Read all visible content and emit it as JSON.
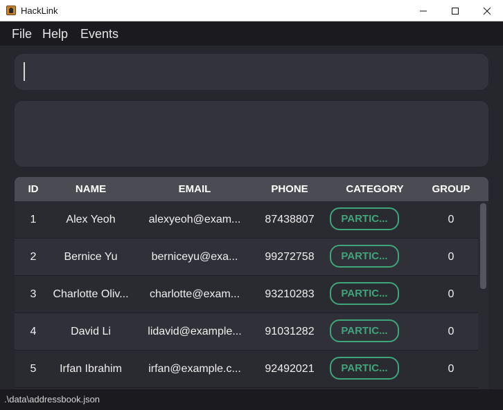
{
  "window": {
    "title": "HackLink",
    "icon": "app-icon"
  },
  "menu": {
    "items": [
      "File",
      "Help",
      "Events"
    ]
  },
  "command_box": {
    "value": "",
    "placeholder": ""
  },
  "result_box": {
    "text": ""
  },
  "table": {
    "headers": [
      "ID",
      "NAME",
      "EMAIL",
      "PHONE",
      "CATEGORY",
      "GROUP"
    ],
    "rows": [
      {
        "id": "1",
        "name": "Alex Yeoh",
        "email": "alexyeoh@exam...",
        "phone": "87438807",
        "category": "PARTIC...",
        "group": "0"
      },
      {
        "id": "2",
        "name": "Bernice Yu",
        "email": "berniceyu@exa...",
        "phone": "99272758",
        "category": "PARTIC...",
        "group": "0"
      },
      {
        "id": "3",
        "name": "Charlotte Oliv...",
        "email": "charlotte@exam...",
        "phone": "93210283",
        "category": "PARTIC...",
        "group": "0"
      },
      {
        "id": "4",
        "name": "David Li",
        "email": "lidavid@example...",
        "phone": "91031282",
        "category": "PARTIC...",
        "group": "0"
      },
      {
        "id": "5",
        "name": "Irfan Ibrahim",
        "email": "irfan@example.c...",
        "phone": "92492021",
        "category": "PARTIC...",
        "group": "0"
      }
    ]
  },
  "status": {
    "path": ".\\data\\addressbook.json"
  },
  "colors": {
    "category_accent": "#3fa57a",
    "background": "#1e1e24",
    "header": "#4b4b53"
  }
}
